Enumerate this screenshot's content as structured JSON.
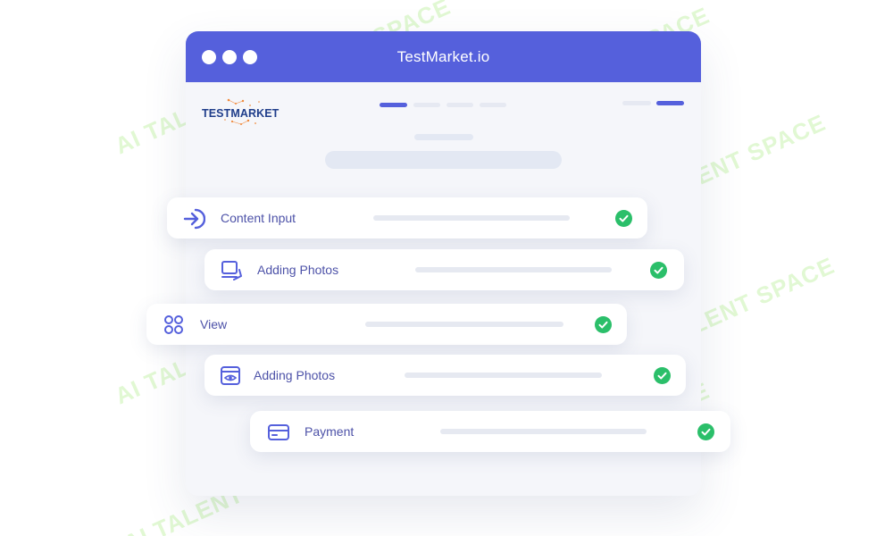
{
  "window": {
    "title": "TestMarket.io",
    "control_dots": [
      "dot",
      "dot",
      "dot"
    ]
  },
  "header": {
    "logo_text": "TESTMARKET",
    "nav_bars": [
      "active",
      "idle",
      "idle",
      "idle"
    ],
    "right_bars": [
      "idle",
      "active"
    ]
  },
  "steps": [
    {
      "label": "Content Input",
      "icon": "arrow-enter-icon",
      "status": "complete"
    },
    {
      "label": "Adding Photos",
      "icon": "photos-stack-icon",
      "status": "complete"
    },
    {
      "label": "View",
      "icon": "grid-icon",
      "status": "complete"
    },
    {
      "label": "Adding Photos",
      "icon": "eye-window-icon",
      "status": "complete"
    },
    {
      "label": "Payment",
      "icon": "credit-card-icon",
      "status": "complete"
    }
  ],
  "colors": {
    "accent": "#5560dc",
    "check": "#2bbf6a",
    "label": "#4d52a8"
  },
  "watermark": {
    "text": "AI TALENT SPACE"
  }
}
